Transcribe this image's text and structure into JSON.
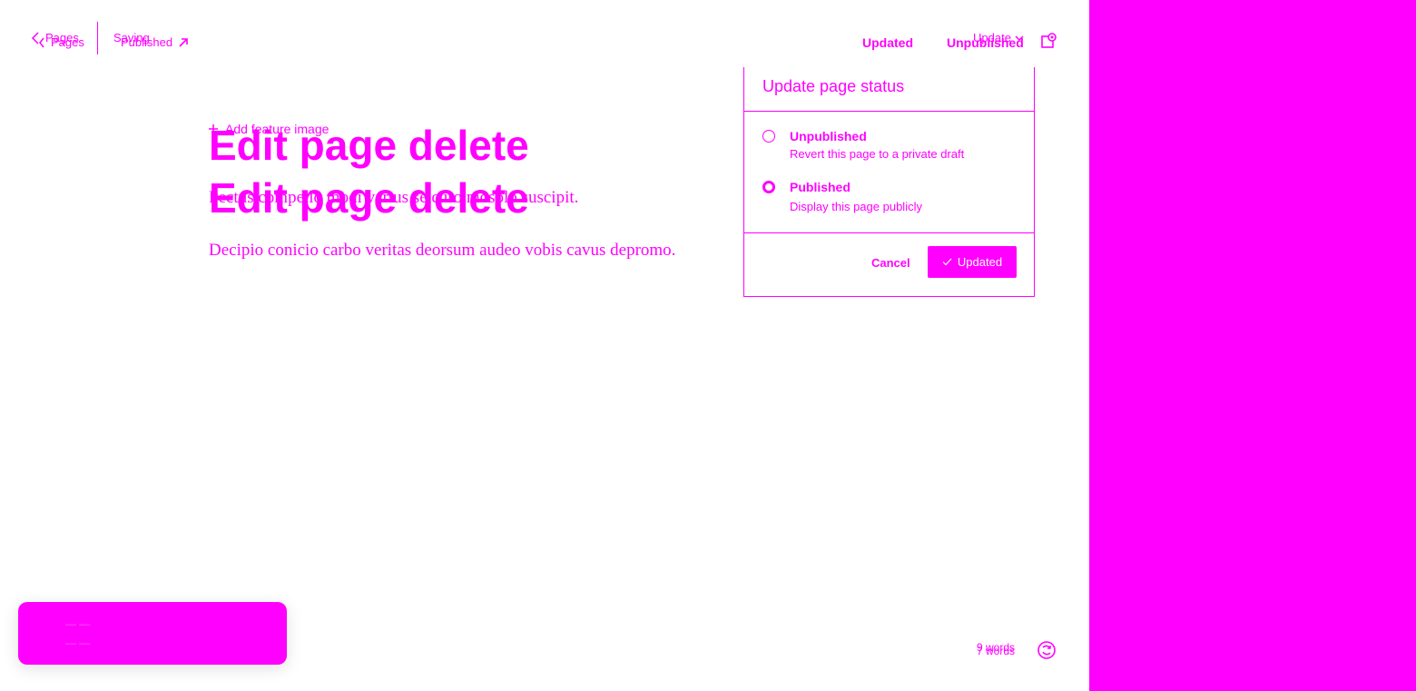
{
  "header": {
    "back_label_a": "Pages",
    "back_label_b": "Pages",
    "saving_label": "Saving",
    "published_link_label": "Published",
    "updated_label": "Updated",
    "unpublished_label": "Unpublished",
    "update_menu_label": "Update"
  },
  "editor": {
    "add_feature_label": "Add feature image",
    "title_a": "Edit page delete",
    "title_b": "Edit page delete",
    "paragraph_a": "Pectus compello modi varius se curo mosolo suscipit.",
    "paragraph_b": "Decipio conicio carbo veritas deorsum audeo vobis cavus depromo."
  },
  "status_popover": {
    "title": "Update page status",
    "options": [
      {
        "label": "Unpublished",
        "description": "Revert this page to a private draft",
        "selected": false
      },
      {
        "label": "Published",
        "description": "Display this page publicly",
        "selected": true
      }
    ],
    "cancel_label": "Cancel",
    "confirm_label": "Updated"
  },
  "footer": {
    "word_count_a": "9 words",
    "word_count_b": "7 words"
  },
  "colors": {
    "accent": "#ff00ff",
    "background": "#ffffff"
  },
  "icons": {
    "back": "chevron-left-icon",
    "external": "arrow-up-right-icon",
    "dropdown": "chevron-down-icon",
    "settings": "settings-icon",
    "add": "plus-icon",
    "check": "check-icon",
    "sync": "sync-icon"
  }
}
